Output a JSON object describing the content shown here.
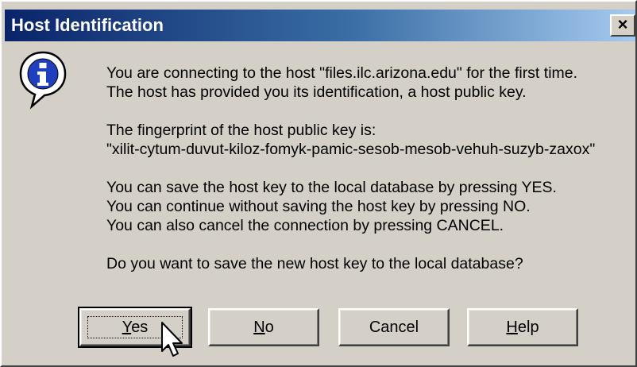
{
  "window": {
    "title": "Host Identification",
    "close_label": "×"
  },
  "message": {
    "lines": [
      "You are connecting to the host \"files.ilc.arizona.edu\" for the first time.",
      "The host has provided you its identification, a host public key.",
      "The fingerprint of the host public key is:",
      "\"xilit-cytum-duvut-kiloz-fomyk-pamic-sesob-mesob-vehuh-suzyb-zaxox\"",
      "You can save the host key to the local database by pressing YES.",
      "You can continue without saving the host key by pressing NO.",
      "You can also cancel the connection by pressing CANCEL.",
      "Do you want to save the new host key to the local database?"
    ]
  },
  "buttons": {
    "yes": {
      "mnemonic": "Y",
      "rest": "es"
    },
    "no": {
      "mnemonic": "N",
      "rest": "o"
    },
    "cancel": {
      "label": "Cancel"
    },
    "help": {
      "mnemonic": "H",
      "rest": "elp"
    }
  },
  "icons": {
    "info": "information-icon",
    "cursor": "mouse-pointer-icon"
  },
  "colors": {
    "titlebar_start": "#0a246a",
    "titlebar_end": "#a6caf0",
    "info_blue": "#1f3fbf",
    "face": "#d4d0c8"
  }
}
